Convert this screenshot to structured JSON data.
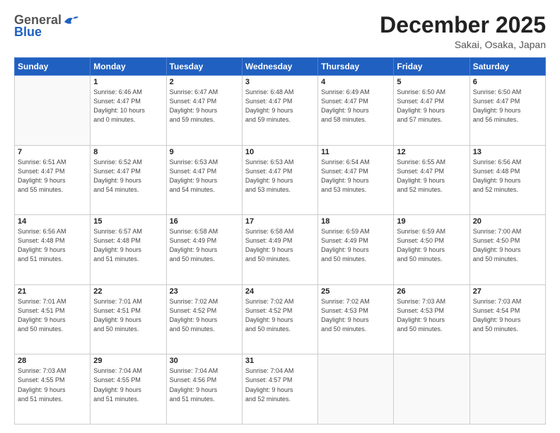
{
  "header": {
    "logo_general": "General",
    "logo_blue": "Blue",
    "month_title": "December 2025",
    "location": "Sakai, Osaka, Japan"
  },
  "days_of_week": [
    "Sunday",
    "Monday",
    "Tuesday",
    "Wednesday",
    "Thursday",
    "Friday",
    "Saturday"
  ],
  "weeks": [
    [
      {
        "day": "",
        "info": ""
      },
      {
        "day": "1",
        "info": "Sunrise: 6:46 AM\nSunset: 4:47 PM\nDaylight: 10 hours\nand 0 minutes."
      },
      {
        "day": "2",
        "info": "Sunrise: 6:47 AM\nSunset: 4:47 PM\nDaylight: 9 hours\nand 59 minutes."
      },
      {
        "day": "3",
        "info": "Sunrise: 6:48 AM\nSunset: 4:47 PM\nDaylight: 9 hours\nand 59 minutes."
      },
      {
        "day": "4",
        "info": "Sunrise: 6:49 AM\nSunset: 4:47 PM\nDaylight: 9 hours\nand 58 minutes."
      },
      {
        "day": "5",
        "info": "Sunrise: 6:50 AM\nSunset: 4:47 PM\nDaylight: 9 hours\nand 57 minutes."
      },
      {
        "day": "6",
        "info": "Sunrise: 6:50 AM\nSunset: 4:47 PM\nDaylight: 9 hours\nand 56 minutes."
      }
    ],
    [
      {
        "day": "7",
        "info": "Sunrise: 6:51 AM\nSunset: 4:47 PM\nDaylight: 9 hours\nand 55 minutes."
      },
      {
        "day": "8",
        "info": "Sunrise: 6:52 AM\nSunset: 4:47 PM\nDaylight: 9 hours\nand 54 minutes."
      },
      {
        "day": "9",
        "info": "Sunrise: 6:53 AM\nSunset: 4:47 PM\nDaylight: 9 hours\nand 54 minutes."
      },
      {
        "day": "10",
        "info": "Sunrise: 6:53 AM\nSunset: 4:47 PM\nDaylight: 9 hours\nand 53 minutes."
      },
      {
        "day": "11",
        "info": "Sunrise: 6:54 AM\nSunset: 4:47 PM\nDaylight: 9 hours\nand 53 minutes."
      },
      {
        "day": "12",
        "info": "Sunrise: 6:55 AM\nSunset: 4:47 PM\nDaylight: 9 hours\nand 52 minutes."
      },
      {
        "day": "13",
        "info": "Sunrise: 6:56 AM\nSunset: 4:48 PM\nDaylight: 9 hours\nand 52 minutes."
      }
    ],
    [
      {
        "day": "14",
        "info": "Sunrise: 6:56 AM\nSunset: 4:48 PM\nDaylight: 9 hours\nand 51 minutes."
      },
      {
        "day": "15",
        "info": "Sunrise: 6:57 AM\nSunset: 4:48 PM\nDaylight: 9 hours\nand 51 minutes."
      },
      {
        "day": "16",
        "info": "Sunrise: 6:58 AM\nSunset: 4:49 PM\nDaylight: 9 hours\nand 50 minutes."
      },
      {
        "day": "17",
        "info": "Sunrise: 6:58 AM\nSunset: 4:49 PM\nDaylight: 9 hours\nand 50 minutes."
      },
      {
        "day": "18",
        "info": "Sunrise: 6:59 AM\nSunset: 4:49 PM\nDaylight: 9 hours\nand 50 minutes."
      },
      {
        "day": "19",
        "info": "Sunrise: 6:59 AM\nSunset: 4:50 PM\nDaylight: 9 hours\nand 50 minutes."
      },
      {
        "day": "20",
        "info": "Sunrise: 7:00 AM\nSunset: 4:50 PM\nDaylight: 9 hours\nand 50 minutes."
      }
    ],
    [
      {
        "day": "21",
        "info": "Sunrise: 7:01 AM\nSunset: 4:51 PM\nDaylight: 9 hours\nand 50 minutes."
      },
      {
        "day": "22",
        "info": "Sunrise: 7:01 AM\nSunset: 4:51 PM\nDaylight: 9 hours\nand 50 minutes."
      },
      {
        "day": "23",
        "info": "Sunrise: 7:02 AM\nSunset: 4:52 PM\nDaylight: 9 hours\nand 50 minutes."
      },
      {
        "day": "24",
        "info": "Sunrise: 7:02 AM\nSunset: 4:52 PM\nDaylight: 9 hours\nand 50 minutes."
      },
      {
        "day": "25",
        "info": "Sunrise: 7:02 AM\nSunset: 4:53 PM\nDaylight: 9 hours\nand 50 minutes."
      },
      {
        "day": "26",
        "info": "Sunrise: 7:03 AM\nSunset: 4:53 PM\nDaylight: 9 hours\nand 50 minutes."
      },
      {
        "day": "27",
        "info": "Sunrise: 7:03 AM\nSunset: 4:54 PM\nDaylight: 9 hours\nand 50 minutes."
      }
    ],
    [
      {
        "day": "28",
        "info": "Sunrise: 7:03 AM\nSunset: 4:55 PM\nDaylight: 9 hours\nand 51 minutes."
      },
      {
        "day": "29",
        "info": "Sunrise: 7:04 AM\nSunset: 4:55 PM\nDaylight: 9 hours\nand 51 minutes."
      },
      {
        "day": "30",
        "info": "Sunrise: 7:04 AM\nSunset: 4:56 PM\nDaylight: 9 hours\nand 51 minutes."
      },
      {
        "day": "31",
        "info": "Sunrise: 7:04 AM\nSunset: 4:57 PM\nDaylight: 9 hours\nand 52 minutes."
      },
      {
        "day": "",
        "info": ""
      },
      {
        "day": "",
        "info": ""
      },
      {
        "day": "",
        "info": ""
      }
    ]
  ]
}
